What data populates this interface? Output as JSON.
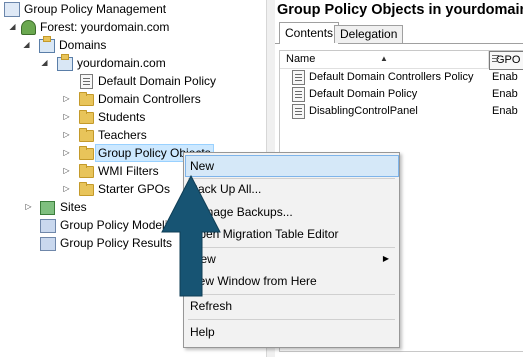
{
  "tree": {
    "items": [
      {
        "label": "Group Policy Management",
        "icon": "gpm-icon",
        "expander": ""
      },
      {
        "label": "Forest: yourdomain.com",
        "icon": "forest-icon",
        "expander": "◢"
      },
      {
        "label": "Domains",
        "icon": "domains-icon",
        "expander": "◢"
      },
      {
        "label": "yourdomain.com",
        "icon": "domain-icon",
        "expander": "◢"
      },
      {
        "label": "Default Domain Policy",
        "icon": "gpo-link-icon",
        "expander": ""
      },
      {
        "label": "Domain Controllers",
        "icon": "folder-icon",
        "expander": "▷"
      },
      {
        "label": "Students",
        "icon": "folder-icon",
        "expander": "▷"
      },
      {
        "label": "Teachers",
        "icon": "folder-icon",
        "expander": "▷"
      },
      {
        "label": "Group Policy Objects",
        "icon": "folder-icon",
        "expander": "▷"
      },
      {
        "label": "WMI Filters",
        "icon": "wmi-filter-icon",
        "expander": "▷"
      },
      {
        "label": "Starter GPOs",
        "icon": "folder-icon",
        "expander": "▷"
      },
      {
        "label": "Sites",
        "icon": "sites-icon",
        "expander": "▷"
      },
      {
        "label": "Group Policy Modeling",
        "icon": "modeling-icon",
        "expander": ""
      },
      {
        "label": "Group Policy Results",
        "icon": "results-icon",
        "expander": ""
      }
    ]
  },
  "right": {
    "title": "Group Policy Objects in yourdomain",
    "tabs": [
      {
        "label": "Contents"
      },
      {
        "label": "Delegation"
      }
    ],
    "columns": {
      "name": "Name",
      "gpo": "GPO"
    },
    "rows": [
      {
        "name": "Default Domain Controllers Policy",
        "status": "Enab"
      },
      {
        "name": "Default Domain Policy",
        "status": "Enab"
      },
      {
        "name": "DisablingControlPanel",
        "status": "Enab"
      }
    ]
  },
  "menu": {
    "items": [
      {
        "label": "New",
        "highlighted": true
      },
      {
        "label": "Back Up All..."
      },
      {
        "label": "Manage Backups..."
      },
      {
        "label": "Open Migration Table Editor"
      },
      {
        "label": "View",
        "submenu": true
      },
      {
        "label": "New Window from Here"
      },
      {
        "label": "Refresh"
      },
      {
        "label": "Help"
      }
    ]
  },
  "colors": {
    "selection": "#cce8ff",
    "menu_highlight": "#d5e8f8",
    "arrow": "#175473"
  }
}
